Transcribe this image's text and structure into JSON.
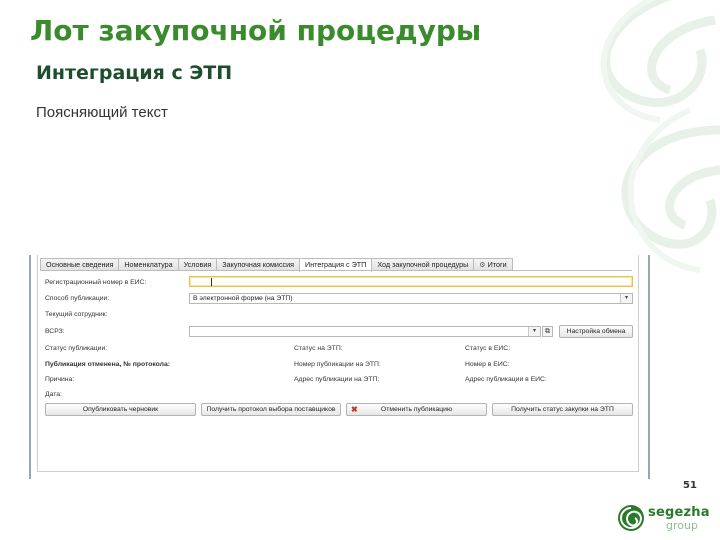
{
  "slide": {
    "title": "Лот закупочной процедуры",
    "subtitle": "Интеграция с ЭТП",
    "explanatory_text": "Поясняющий текст",
    "page_number": "51",
    "logo": {
      "line1": "segezha",
      "line2": "group"
    }
  },
  "screenshot": {
    "tabs": [
      {
        "label": "Основные сведения",
        "active": false
      },
      {
        "label": "Номенклатура",
        "active": false
      },
      {
        "label": "Условия",
        "active": false
      },
      {
        "label": "Закупочная комиссия",
        "active": false
      },
      {
        "label": "Интеграция с ЭТП",
        "active": true
      },
      {
        "label": "Ход закупочной процедуры",
        "active": false
      },
      {
        "label": "Итоги",
        "active": false,
        "icon": "gear-icon"
      }
    ],
    "fields": {
      "reg_number_label": "Регистрационный номер в ЕИС:",
      "reg_number_value": "",
      "pub_method_label": "Способ публикации:",
      "pub_method_value": "В электронной форме (на ЭТП)",
      "current_employee_label": "Текущий сотрудник:",
      "vsrz_label": "ВСРЗ:",
      "vsrz_value": "",
      "vsrz_dropdown_symbol": "▾",
      "vsrz_open_symbol": "⧉",
      "exchange_settings_label": "Настройка обмена"
    },
    "status": {
      "pub_status_label": "Статус публикации:",
      "etp_status_label": "Статус на ЭТП:",
      "eis_status_label": "Статус в ЕИС:",
      "pub_cancelled_label": "Публикация отменена, № протокола:",
      "etp_pub_number_label": "Номер публикации на ЭТП:",
      "eis_number_label": "Номер в ЕИС:",
      "reason_label": "Причина:",
      "etp_pub_address_label": "Адрес публикации на ЭТП:",
      "eis_pub_address_label": "Адрес публикации в ЕИС:",
      "date_label": "Дата:"
    },
    "buttons": {
      "publish_draft": "Опубликовать черновик",
      "get_supplier_protocol": "Получить протокол выбора поставщиков",
      "cancel_publication": "Отменить публикацию",
      "cancel_icon_glyph": "✖",
      "get_eis_status": "Получить статус закупки на ЭТП"
    }
  },
  "colors": {
    "title_green": "#3a8b2c",
    "subtitle_dark_green": "#1f4e2f",
    "focus_yellow": "#e6c24a"
  }
}
